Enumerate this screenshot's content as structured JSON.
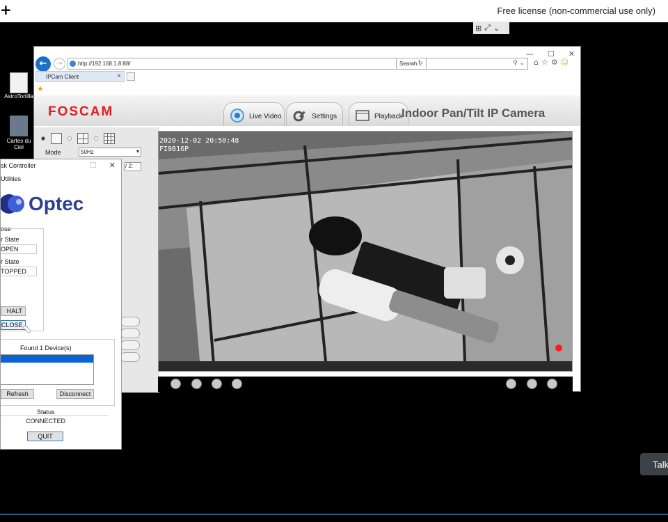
{
  "topbar": {
    "plus": "+",
    "license": "Free license (non-commercial use only)"
  },
  "mini_tools": [
    "⊞",
    "⤢",
    "⌄"
  ],
  "desktop": [
    {
      "label": "AstroTortilla"
    },
    {
      "label": "Cartes du Ciel"
    }
  ],
  "browser": {
    "url": "http://192.168.1.8:88/",
    "search_placeholder": "Search...",
    "tab_title": "IPCam Client",
    "window_controls": [
      "—",
      "☐",
      "✕"
    ]
  },
  "foscam": {
    "logo": "FOSCAM",
    "tabs": {
      "live": "Live Video",
      "settings": "Settings",
      "playback": "Playback"
    },
    "product_title": "Indoor Pan/Tilt IP Camera",
    "mode_label": "Mode",
    "mode_value": "50Hz",
    "second_select": "/ 2:"
  },
  "video": {
    "timestamp": "2020-12-02 20:50:48",
    "camera_id": "FI9816P"
  },
  "optec": {
    "title": "sk Controller",
    "window_controls": [
      "—",
      "☐",
      "✕"
    ],
    "menu": "Utilities",
    "brand": "Optec",
    "group_label": "ose",
    "label1": "r State",
    "value1": "OPEN",
    "label2": "r State",
    "value2": "TOPPED",
    "halt": "HALT",
    "close": "CLOSE",
    "found": "Found 1 Device(s)",
    "refresh": "Refresh",
    "disconnect": "Disconnect",
    "status_label": "Status",
    "status_value": "CONNECTED",
    "quit": "QUIT"
  },
  "talk": "Talk",
  "colors": {
    "foscam_red": "#e02020",
    "optec_blue": "#2c3f8f",
    "ie_blue": "#1e6fc7",
    "selection": "#0a64d8"
  }
}
